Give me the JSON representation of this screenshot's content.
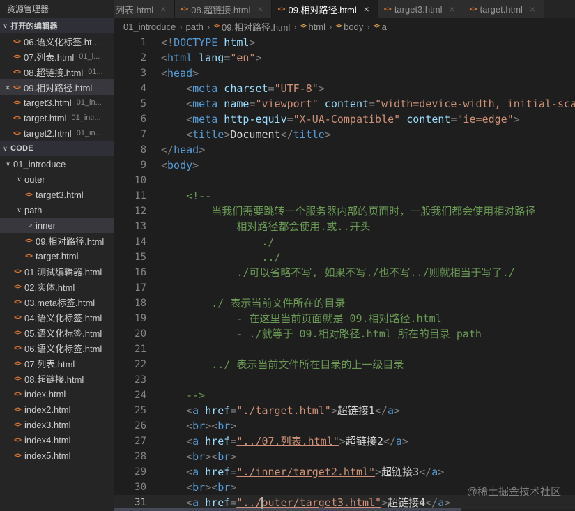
{
  "colors": {
    "accent_file_icon": "#e37933",
    "tag": "#569cd6",
    "attr": "#9cdcfe",
    "string": "#ce9178",
    "comment": "#6a9955",
    "punct": "#808080",
    "selection_bg": "#37373d"
  },
  "icons": {
    "html_file": "<>",
    "close": "×",
    "chevron_expanded": "∨",
    "chevron_collapsed": ">",
    "breadcrumb_separator": "›"
  },
  "explorer": {
    "title": "资源管理器",
    "open_editors_header": "打开的编辑器",
    "code_header": "CODE",
    "open_editors": [
      {
        "name": "06.语义化标签.ht...",
        "desc": "",
        "active": false
      },
      {
        "name": "07.列表.html",
        "desc": "01_i...",
        "active": false
      },
      {
        "name": "08.超链接.html",
        "desc": "01...",
        "active": false
      },
      {
        "name": "09.相对路径.html",
        "desc": "...",
        "active": true
      },
      {
        "name": "target3.html",
        "desc": "01_in...",
        "active": false
      },
      {
        "name": "target.html",
        "desc": "01_intr...",
        "active": false
      },
      {
        "name": "target2.html",
        "desc": "01_in...",
        "active": false
      }
    ],
    "tree": [
      {
        "label": "01_introduce",
        "kind": "folder",
        "level": 0,
        "chevron": "expanded",
        "selected": false
      },
      {
        "label": "outer",
        "kind": "folder",
        "level": 1,
        "chevron": "expanded",
        "selected": false
      },
      {
        "label": "target3.html",
        "kind": "file",
        "level": 2,
        "selected": false
      },
      {
        "label": "path",
        "kind": "folder",
        "level": 1,
        "chevron": "expanded",
        "selected": false
      },
      {
        "label": "inner",
        "kind": "folder",
        "level": 2,
        "chevron": "collapsed",
        "selected": true
      },
      {
        "label": "09.相对路径.html",
        "kind": "file",
        "level": 2,
        "selected": false
      },
      {
        "label": "target.html",
        "kind": "file",
        "level": 2,
        "selected": false
      },
      {
        "label": "01.测试编辑器.html",
        "kind": "file",
        "level": 1,
        "selected": false
      },
      {
        "label": "02.实体.html",
        "kind": "file",
        "level": 1,
        "selected": false
      },
      {
        "label": "03.meta标签.html",
        "kind": "file",
        "level": 1,
        "selected": false
      },
      {
        "label": "04.语义化标签.html",
        "kind": "file",
        "level": 1,
        "selected": false
      },
      {
        "label": "05.语义化标签.html",
        "kind": "file",
        "level": 1,
        "selected": false
      },
      {
        "label": "06.语义化标签.html",
        "kind": "file",
        "level": 1,
        "selected": false
      },
      {
        "label": "07.列表.html",
        "kind": "file",
        "level": 1,
        "selected": false
      },
      {
        "label": "08.超链接.html",
        "kind": "file",
        "level": 1,
        "selected": false
      },
      {
        "label": "index.html",
        "kind": "file",
        "level": 1,
        "selected": false
      },
      {
        "label": "index2.html",
        "kind": "file",
        "level": 1,
        "selected": false
      },
      {
        "label": "index3.html",
        "kind": "file",
        "level": 1,
        "selected": false
      },
      {
        "label": "index4.html",
        "kind": "file",
        "level": 1,
        "selected": false
      },
      {
        "label": "index5.html",
        "kind": "file",
        "level": 1,
        "selected": false
      }
    ]
  },
  "tabs": [
    {
      "label": "列表.html",
      "active": false,
      "partial": true,
      "icon": false
    },
    {
      "label": "08.超链接.html",
      "active": false,
      "partial": false,
      "icon": true
    },
    {
      "label": "09.相对路径.html",
      "active": true,
      "partial": false,
      "icon": true
    },
    {
      "label": "target3.html",
      "active": false,
      "partial": false,
      "icon": true
    },
    {
      "label": "target.html",
      "active": false,
      "partial": false,
      "icon": true
    }
  ],
  "breadcrumb": [
    {
      "label": "01_introduce",
      "icon": ""
    },
    {
      "label": "path",
      "icon": ""
    },
    {
      "label": "09.相对路径.html",
      "icon": "file"
    },
    {
      "label": "html",
      "icon": "sym"
    },
    {
      "label": "body",
      "icon": "sym"
    },
    {
      "label": "a",
      "icon": "sym"
    }
  ],
  "editor": {
    "current_line": 31,
    "lines": [
      [
        [
          "p",
          "<!"
        ],
        [
          "t",
          "DOCTYPE"
        ],
        [
          "a",
          " html"
        ],
        [
          "p",
          ">"
        ]
      ],
      [
        [
          "p",
          "<"
        ],
        [
          "t",
          "html"
        ],
        [
          "a",
          " lang"
        ],
        [
          "p",
          "="
        ],
        [
          "s",
          "\"en\""
        ],
        [
          "p",
          ">"
        ]
      ],
      [
        [
          "p",
          "<"
        ],
        [
          "t",
          "head"
        ],
        [
          "p",
          ">"
        ]
      ],
      [
        [
          "x",
          "    "
        ],
        [
          "p",
          "<"
        ],
        [
          "t",
          "meta"
        ],
        [
          "a",
          " charset"
        ],
        [
          "p",
          "="
        ],
        [
          "s",
          "\"UTF-8\""
        ],
        [
          "p",
          ">"
        ]
      ],
      [
        [
          "x",
          "    "
        ],
        [
          "p",
          "<"
        ],
        [
          "t",
          "meta"
        ],
        [
          "a",
          " name"
        ],
        [
          "p",
          "="
        ],
        [
          "s",
          "\"viewport\""
        ],
        [
          "a",
          " content"
        ],
        [
          "p",
          "="
        ],
        [
          "s",
          "\"width=device-width, initial-scal"
        ]
      ],
      [
        [
          "x",
          "    "
        ],
        [
          "p",
          "<"
        ],
        [
          "t",
          "meta"
        ],
        [
          "a",
          " http-equiv"
        ],
        [
          "p",
          "="
        ],
        [
          "s",
          "\"X-UA-Compatible\""
        ],
        [
          "a",
          " content"
        ],
        [
          "p",
          "="
        ],
        [
          "s",
          "\"ie=edge\""
        ],
        [
          "p",
          ">"
        ]
      ],
      [
        [
          "x",
          "    "
        ],
        [
          "p",
          "<"
        ],
        [
          "t",
          "title"
        ],
        [
          "p",
          ">"
        ],
        [
          "x",
          "Document"
        ],
        [
          "p",
          "</"
        ],
        [
          "t",
          "title"
        ],
        [
          "p",
          ">"
        ]
      ],
      [
        [
          "p",
          "</"
        ],
        [
          "t",
          "head"
        ],
        [
          "p",
          ">"
        ]
      ],
      [
        [
          "p",
          "<"
        ],
        [
          "t",
          "body"
        ],
        [
          "p",
          ">"
        ]
      ],
      [],
      [
        [
          "c",
          "    <!--"
        ]
      ],
      [
        [
          "c",
          "        当我们需要跳转一个服务器内部的页面时，一般我们都会使用相对路径"
        ]
      ],
      [
        [
          "c",
          "            相对路径都会使用.或..开头"
        ]
      ],
      [
        [
          "c",
          "                ./"
        ]
      ],
      [
        [
          "c",
          "                ../"
        ]
      ],
      [
        [
          "c",
          "            ./可以省略不写, 如果不写./也不写../则就相当于写了./"
        ]
      ],
      [],
      [
        [
          "c",
          "        ./ 表示当前文件所在的目录"
        ]
      ],
      [
        [
          "c",
          "            - 在这里当前页面就是 09.相对路径.html"
        ]
      ],
      [
        [
          "c",
          "            - ./就等于 09.相对路径.html 所在的目录 path"
        ]
      ],
      [],
      [
        [
          "c",
          "        ../ 表示当前文件所在目录的上一级目录"
        ]
      ],
      [],
      [
        [
          "c",
          "    -->"
        ]
      ],
      [
        [
          "x",
          "    "
        ],
        [
          "p",
          "<"
        ],
        [
          "t",
          "a"
        ],
        [
          "a",
          " href"
        ],
        [
          "p",
          "="
        ],
        [
          "u",
          "\"./target.html\""
        ],
        [
          "p",
          ">"
        ],
        [
          "x",
          "超链接1"
        ],
        [
          "p",
          "</"
        ],
        [
          "t",
          "a"
        ],
        [
          "p",
          ">"
        ]
      ],
      [
        [
          "x",
          "    "
        ],
        [
          "p",
          "<"
        ],
        [
          "t",
          "br"
        ],
        [
          "p",
          ">"
        ],
        [
          "p",
          "<"
        ],
        [
          "t",
          "br"
        ],
        [
          "p",
          ">"
        ]
      ],
      [
        [
          "x",
          "    "
        ],
        [
          "p",
          "<"
        ],
        [
          "t",
          "a"
        ],
        [
          "a",
          " href"
        ],
        [
          "p",
          "="
        ],
        [
          "u",
          "\"../07.列表.html\""
        ],
        [
          "p",
          ">"
        ],
        [
          "x",
          "超链接2"
        ],
        [
          "p",
          "</"
        ],
        [
          "t",
          "a"
        ],
        [
          "p",
          ">"
        ]
      ],
      [
        [
          "x",
          "    "
        ],
        [
          "p",
          "<"
        ],
        [
          "t",
          "br"
        ],
        [
          "p",
          ">"
        ],
        [
          "p",
          "<"
        ],
        [
          "t",
          "br"
        ],
        [
          "p",
          ">"
        ]
      ],
      [
        [
          "x",
          "    "
        ],
        [
          "p",
          "<"
        ],
        [
          "t",
          "a"
        ],
        [
          "a",
          " href"
        ],
        [
          "p",
          "="
        ],
        [
          "u",
          "\"./inner/target2.html\""
        ],
        [
          "p",
          ">"
        ],
        [
          "x",
          "超链接3"
        ],
        [
          "p",
          "</"
        ],
        [
          "t",
          "a"
        ],
        [
          "p",
          ">"
        ]
      ],
      [
        [
          "x",
          "    "
        ],
        [
          "p",
          "<"
        ],
        [
          "t",
          "br"
        ],
        [
          "p",
          ">"
        ],
        [
          "p",
          "<"
        ],
        [
          "t",
          "br"
        ],
        [
          "p",
          ">"
        ]
      ],
      [
        [
          "x",
          "    "
        ],
        [
          "p",
          "<"
        ],
        [
          "t",
          "a"
        ],
        [
          "a",
          " href"
        ],
        [
          "p",
          "="
        ],
        [
          "u",
          "\"../"
        ],
        [
          "caret",
          ""
        ],
        [
          "u",
          "outer/target3.html\""
        ],
        [
          "p",
          ">"
        ],
        [
          "x",
          "超链接4"
        ],
        [
          "p",
          "</"
        ],
        [
          "t",
          "a"
        ],
        [
          "p",
          ">"
        ]
      ]
    ]
  },
  "watermark": "@稀土掘金技术社区"
}
